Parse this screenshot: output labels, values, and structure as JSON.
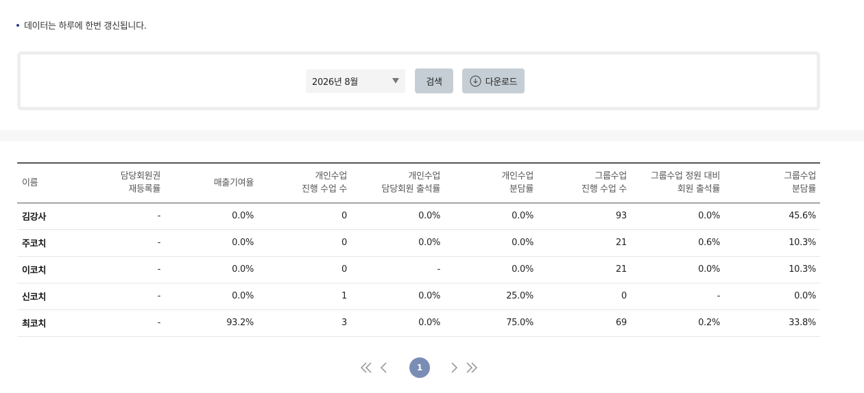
{
  "notice": {
    "text": "데이터는 하루에 한번 갱신됩니다."
  },
  "filter": {
    "month_value": "2026년 8월",
    "search_label": "검색",
    "download_label": "다운로드"
  },
  "table": {
    "headers": [
      [
        "이름",
        ""
      ],
      [
        "담당회원권",
        "재등록률"
      ],
      [
        "매출기여율",
        ""
      ],
      [
        "개인수업",
        "진행 수업 수"
      ],
      [
        "개인수업",
        "담당회원 출석률"
      ],
      [
        "개인수업",
        "분담률"
      ],
      [
        "그룹수업",
        "진행 수업 수"
      ],
      [
        "그룹수업 정원 대비",
        "회원 출석률"
      ],
      [
        "그룹수업",
        "분담률"
      ]
    ],
    "rows": [
      [
        "김강사",
        "-",
        "0.0%",
        "0",
        "0.0%",
        "0.0%",
        "93",
        "0.0%",
        "45.6%"
      ],
      [
        "주코치",
        "-",
        "0.0%",
        "0",
        "0.0%",
        "0.0%",
        "21",
        "0.6%",
        "10.3%"
      ],
      [
        "이코치",
        "-",
        "0.0%",
        "0",
        "-",
        "0.0%",
        "21",
        "0.0%",
        "10.3%"
      ],
      [
        "신코치",
        "-",
        "0.0%",
        "1",
        "0.0%",
        "25.0%",
        "0",
        "-",
        "0.0%"
      ],
      [
        "최코치",
        "-",
        "93.2%",
        "3",
        "0.0%",
        "75.0%",
        "69",
        "0.2%",
        "33.8%"
      ]
    ]
  },
  "pagination": {
    "current_page": "1"
  },
  "colors": {
    "accent": "#7a8db5",
    "button_bg": "#c5ced4",
    "bullet": "#2b3a8c"
  }
}
